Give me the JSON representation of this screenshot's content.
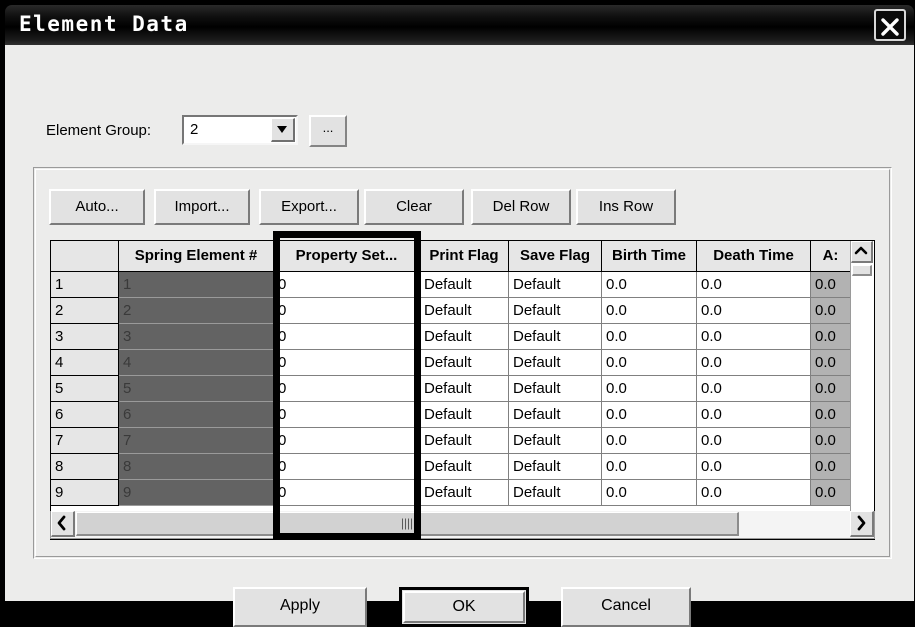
{
  "window": {
    "title": "Element Data",
    "close_icon": "close-x-icon"
  },
  "element_group": {
    "label": "Element Group:",
    "value": "2",
    "dropdown_icon": "chevron-down-icon",
    "browse_label": "..."
  },
  "toolbar": {
    "auto": "Auto...",
    "import": "Import...",
    "export": "Export...",
    "clear": "Clear",
    "del_row": "Del Row",
    "ins_row": "Ins Row"
  },
  "grid": {
    "headers": [
      "",
      "Spring Element #",
      "Property Set...",
      "Print Flag",
      "Save Flag",
      "Birth Time",
      "Death Time",
      "A:"
    ],
    "rows": [
      [
        "1",
        "1",
        "0",
        "Default",
        "Default",
        "0.0",
        "0.0",
        "0.0"
      ],
      [
        "2",
        "2",
        "0",
        "Default",
        "Default",
        "0.0",
        "0.0",
        "0.0"
      ],
      [
        "3",
        "3",
        "0",
        "Default",
        "Default",
        "0.0",
        "0.0",
        "0.0"
      ],
      [
        "4",
        "4",
        "0",
        "Default",
        "Default",
        "0.0",
        "0.0",
        "0.0"
      ],
      [
        "5",
        "5",
        "0",
        "Default",
        "Default",
        "0.0",
        "0.0",
        "0.0"
      ],
      [
        "6",
        "6",
        "0",
        "Default",
        "Default",
        "0.0",
        "0.0",
        "0.0"
      ],
      [
        "7",
        "7",
        "0",
        "Default",
        "Default",
        "0.0",
        "0.0",
        "0.0"
      ],
      [
        "8",
        "8",
        "0",
        "Default",
        "Default",
        "0.0",
        "0.0",
        "0.0"
      ],
      [
        "9",
        "9",
        "0",
        "Default",
        "Default",
        "0.0",
        "0.0",
        "0.0"
      ]
    ],
    "highlighted_column": "Property Set...",
    "vertical_scrollbar": {
      "up_icon": "chevron-up-icon",
      "down_icon": "chevron-down-icon"
    },
    "horizontal_scrollbar": {
      "left_icon": "chevron-left-icon",
      "right_icon": "chevron-right-icon"
    }
  },
  "footer": {
    "apply": "Apply",
    "ok": "OK",
    "cancel": "Cancel"
  },
  "colors": {
    "dialog_face": "#ececeb",
    "button_face": "#e2e2e2",
    "readonly_cell": "#636363",
    "highlight_border": "#000000",
    "titlebar": "#000000"
  }
}
